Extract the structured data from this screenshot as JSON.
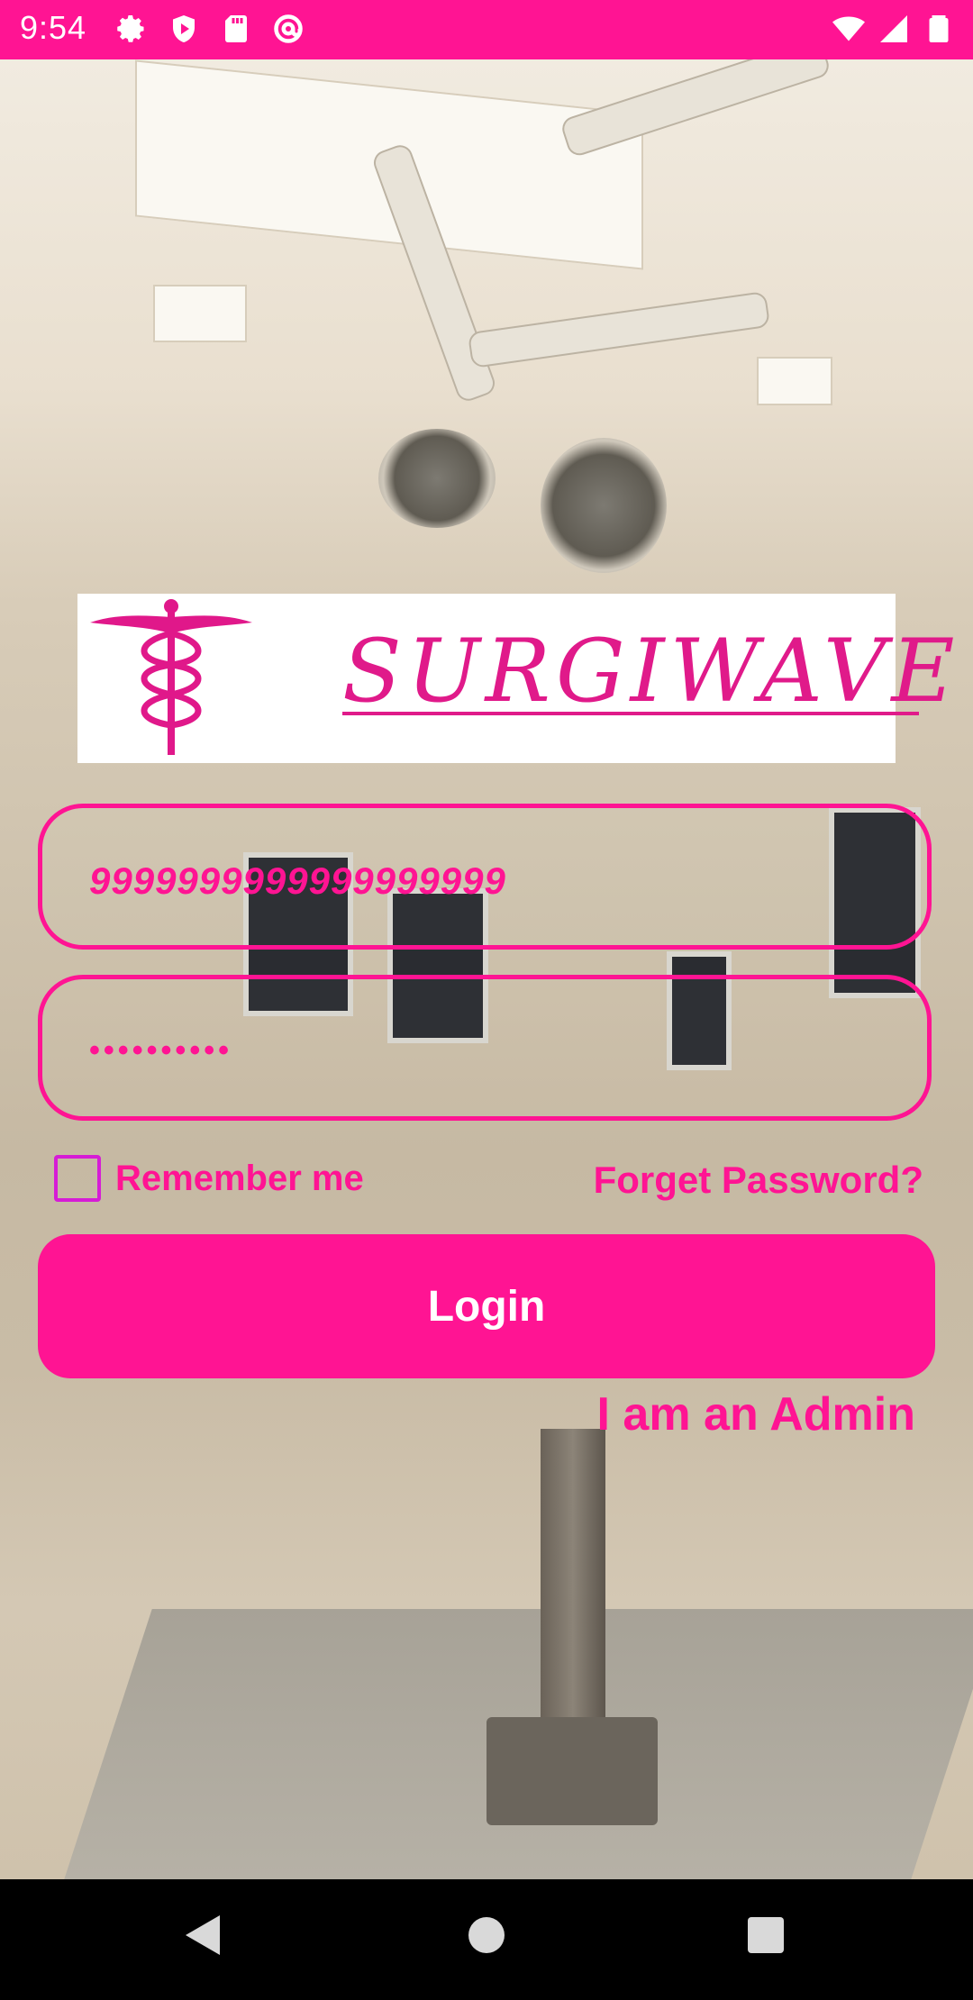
{
  "status_bar": {
    "time": "9:54",
    "icons_left": [
      "settings-icon",
      "play-protect-icon",
      "sd-card-icon",
      "at-sign-icon"
    ],
    "icons_right": [
      "wifi-icon",
      "signal-icon",
      "battery-icon"
    ],
    "color": "#ff1493"
  },
  "logo": {
    "text": "SURGIWAVE",
    "icon": "caduceus-icon",
    "color": "#e01a8a"
  },
  "form": {
    "phone_value": "9999999999999999999",
    "password_value": "••••••••••",
    "remember_label": "Remember me",
    "remember_checked": false,
    "forget_label": "Forget Password?",
    "login_label": "Login",
    "admin_label": "I am an Admin"
  },
  "theme": {
    "accent": "#ff1493",
    "checkbox_border": "#d61cd6"
  },
  "nav_bar": {
    "buttons": [
      "back-icon",
      "home-icon",
      "recents-icon"
    ]
  }
}
